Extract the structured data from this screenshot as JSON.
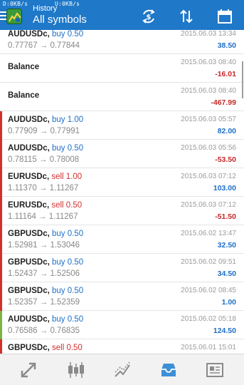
{
  "statusbar": {
    "download": "D:0KB/s",
    "upload": "U:0KB/s"
  },
  "header": {
    "title_small": "History",
    "title_big": "All symbols"
  },
  "colors": {
    "appbar": "#1f78c8",
    "buy": "#1e6fc7",
    "sell": "#d32f2f",
    "profit_positive": "#1e6fc7",
    "profit_negative": "#c62828",
    "sell_marker": "#d32f2f",
    "buy_win_marker": "#7cb342"
  },
  "icons": {
    "symbol_currency": "currency-exchange-icon",
    "sort": "sort-arrows-icon",
    "period": "calendar-icon"
  },
  "deals": [
    {
      "symbol": "AUDUSDc,",
      "side": "buy 0.50",
      "prices": "0.77767 → 0.77844",
      "date": "2015.06.03 13:34",
      "profit": "38.50",
      "type": "buy",
      "sign": "pos",
      "marker": "none"
    },
    {
      "symbol": "Balance",
      "side": "",
      "prices": "",
      "date": "2015.06.03 08:40",
      "profit": "-16.01",
      "type": "balance",
      "sign": "neg",
      "marker": "none"
    },
    {
      "symbol": "Balance",
      "side": "",
      "prices": "",
      "date": "2015.06.03 08:40",
      "profit": "-467.99",
      "type": "balance",
      "sign": "neg",
      "marker": "none"
    },
    {
      "symbol": "AUDUSDc,",
      "side": "buy 1.00",
      "prices": "0.77909 → 0.77991",
      "date": "2015.06.03 05:57",
      "profit": "82.00",
      "type": "buy",
      "sign": "pos",
      "marker": "red"
    },
    {
      "symbol": "AUDUSDc,",
      "side": "buy 0.50",
      "prices": "0.78115 → 0.78008",
      "date": "2015.06.03 05:56",
      "profit": "-53.50",
      "type": "buy",
      "sign": "neg",
      "marker": "red"
    },
    {
      "symbol": "EURUSDc,",
      "side": "sell 1.00",
      "prices": "1.11370 → 1.11267",
      "date": "2015.06.03 07:12",
      "profit": "103.00",
      "type": "sell",
      "sign": "pos",
      "marker": "red"
    },
    {
      "symbol": "EURUSDc,",
      "side": "sell 0.50",
      "prices": "1.11164 → 1.11267",
      "date": "2015.06.03 07:12",
      "profit": "-51.50",
      "type": "sell",
      "sign": "neg",
      "marker": "red"
    },
    {
      "symbol": "GBPUSDc,",
      "side": "buy 0.50",
      "prices": "1.52981 → 1.53046",
      "date": "2015.06.02 13:47",
      "profit": "32.50",
      "type": "buy",
      "sign": "pos",
      "marker": "red"
    },
    {
      "symbol": "GBPUSDc,",
      "side": "buy 0.50",
      "prices": "1.52437 → 1.52506",
      "date": "2015.06.02 09:51",
      "profit": "34.50",
      "type": "buy",
      "sign": "pos",
      "marker": "red"
    },
    {
      "symbol": "GBPUSDc,",
      "side": "buy 0.50",
      "prices": "1.52357 → 1.52359",
      "date": "2015.06.02 08:45",
      "profit": "1.00",
      "type": "buy",
      "sign": "pos",
      "marker": "red"
    },
    {
      "symbol": "AUDUSDc,",
      "side": "buy 0.50",
      "prices": "0.76586 → 0.76835",
      "date": "2015.06.02 05:18",
      "profit": "124.50",
      "type": "buy",
      "sign": "pos",
      "marker": "green"
    },
    {
      "symbol": "GBPUSDc,",
      "side": "sell 0.50",
      "prices": "",
      "date": "2015.06.01 15:01",
      "profit": "",
      "type": "sell",
      "sign": "pos",
      "marker": "red"
    }
  ],
  "bottom_nav": [
    {
      "name": "quotes-nav-icon"
    },
    {
      "name": "chart-nav-icon"
    },
    {
      "name": "trade-nav-icon"
    },
    {
      "name": "history-nav-icon",
      "active": true
    },
    {
      "name": "news-nav-icon"
    }
  ]
}
